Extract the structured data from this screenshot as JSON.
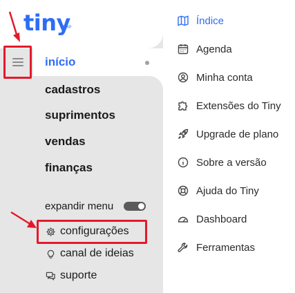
{
  "brand": {
    "name": "tiny",
    "suffix": "ERP",
    "color": "#2d6df6"
  },
  "sidebar": {
    "items": [
      {
        "label": "início",
        "active": true
      },
      {
        "label": "cadastros"
      },
      {
        "label": "suprimentos"
      },
      {
        "label": "vendas"
      },
      {
        "label": "finanças"
      }
    ],
    "expand_menu": {
      "label": "expandir menu",
      "toggle_on": true
    },
    "bottom_items": [
      {
        "label": "configurações",
        "icon": "gear-icon"
      },
      {
        "label": "canal de ideias",
        "icon": "lightbulb-icon"
      },
      {
        "label": "suporte",
        "icon": "chat-icon"
      }
    ]
  },
  "right_menu": {
    "items": [
      {
        "label": "Índice",
        "icon": "map-icon",
        "active": true
      },
      {
        "label": "Agenda",
        "icon": "calendar-icon"
      },
      {
        "label": "Minha conta",
        "icon": "user-icon"
      },
      {
        "label": "Extensões do Tiny",
        "icon": "puzzle-icon"
      },
      {
        "label": "Upgrade de plano",
        "icon": "rocket-icon"
      },
      {
        "label": "Sobre a versão",
        "icon": "info-icon"
      },
      {
        "label": "Ajuda do Tiny",
        "icon": "lifebuoy-icon"
      },
      {
        "label": "Dashboard",
        "icon": "gauge-icon"
      },
      {
        "label": "Ferramentas",
        "icon": "wrench-icon"
      }
    ]
  },
  "colors": {
    "accent": "#2d6df6",
    "highlight": "#e3192b",
    "sidebar_bg": "#e6e6e6"
  }
}
